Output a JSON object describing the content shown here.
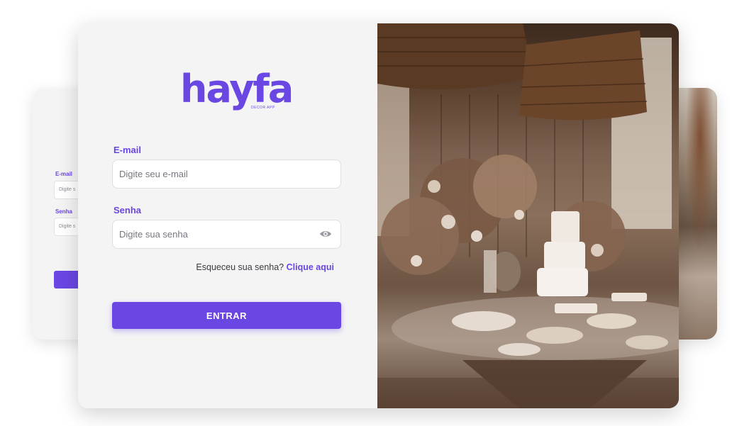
{
  "brand": {
    "name": "hayfa",
    "tagline": "DECOR APP"
  },
  "form": {
    "email_label": "E-mail",
    "email_placeholder": "Digite seu e-mail",
    "password_label": "Senha",
    "password_placeholder": "Digite sua senha",
    "forgot_text": "Esqueceu sua senha?",
    "forgot_link": "Clique aqui",
    "submit_label": "ENTRAR"
  },
  "back_card": {
    "email_label": "E-mail",
    "email_placeholder": "Digite s",
    "password_label": "Senha",
    "password_placeholder": "Digite s"
  },
  "icons": {
    "password_toggle": "eye-icon"
  },
  "colors": {
    "accent": "#6a46e3",
    "panel_bg": "#f4f4f5"
  }
}
